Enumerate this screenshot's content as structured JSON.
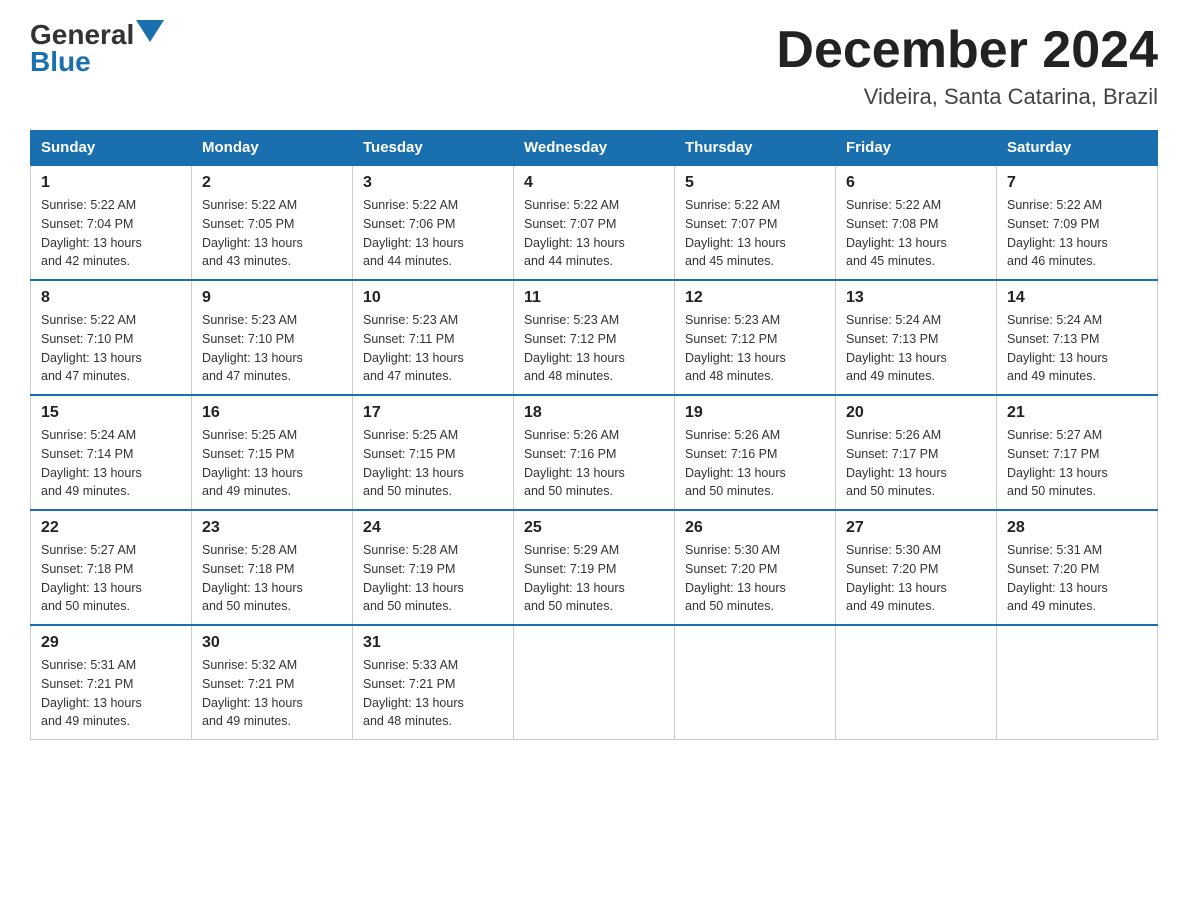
{
  "logo": {
    "text1": "General",
    "text2": "Blue"
  },
  "title": "December 2024",
  "location": "Videira, Santa Catarina, Brazil",
  "days_of_week": [
    "Sunday",
    "Monday",
    "Tuesday",
    "Wednesday",
    "Thursday",
    "Friday",
    "Saturday"
  ],
  "weeks": [
    [
      {
        "day": "1",
        "sunrise": "5:22 AM",
        "sunset": "7:04 PM",
        "daylight": "13 hours and 42 minutes."
      },
      {
        "day": "2",
        "sunrise": "5:22 AM",
        "sunset": "7:05 PM",
        "daylight": "13 hours and 43 minutes."
      },
      {
        "day": "3",
        "sunrise": "5:22 AM",
        "sunset": "7:06 PM",
        "daylight": "13 hours and 44 minutes."
      },
      {
        "day": "4",
        "sunrise": "5:22 AM",
        "sunset": "7:07 PM",
        "daylight": "13 hours and 44 minutes."
      },
      {
        "day": "5",
        "sunrise": "5:22 AM",
        "sunset": "7:07 PM",
        "daylight": "13 hours and 45 minutes."
      },
      {
        "day": "6",
        "sunrise": "5:22 AM",
        "sunset": "7:08 PM",
        "daylight": "13 hours and 45 minutes."
      },
      {
        "day": "7",
        "sunrise": "5:22 AM",
        "sunset": "7:09 PM",
        "daylight": "13 hours and 46 minutes."
      }
    ],
    [
      {
        "day": "8",
        "sunrise": "5:22 AM",
        "sunset": "7:10 PM",
        "daylight": "13 hours and 47 minutes."
      },
      {
        "day": "9",
        "sunrise": "5:23 AM",
        "sunset": "7:10 PM",
        "daylight": "13 hours and 47 minutes."
      },
      {
        "day": "10",
        "sunrise": "5:23 AM",
        "sunset": "7:11 PM",
        "daylight": "13 hours and 47 minutes."
      },
      {
        "day": "11",
        "sunrise": "5:23 AM",
        "sunset": "7:12 PM",
        "daylight": "13 hours and 48 minutes."
      },
      {
        "day": "12",
        "sunrise": "5:23 AM",
        "sunset": "7:12 PM",
        "daylight": "13 hours and 48 minutes."
      },
      {
        "day": "13",
        "sunrise": "5:24 AM",
        "sunset": "7:13 PM",
        "daylight": "13 hours and 49 minutes."
      },
      {
        "day": "14",
        "sunrise": "5:24 AM",
        "sunset": "7:13 PM",
        "daylight": "13 hours and 49 minutes."
      }
    ],
    [
      {
        "day": "15",
        "sunrise": "5:24 AM",
        "sunset": "7:14 PM",
        "daylight": "13 hours and 49 minutes."
      },
      {
        "day": "16",
        "sunrise": "5:25 AM",
        "sunset": "7:15 PM",
        "daylight": "13 hours and 49 minutes."
      },
      {
        "day": "17",
        "sunrise": "5:25 AM",
        "sunset": "7:15 PM",
        "daylight": "13 hours and 50 minutes."
      },
      {
        "day": "18",
        "sunrise": "5:26 AM",
        "sunset": "7:16 PM",
        "daylight": "13 hours and 50 minutes."
      },
      {
        "day": "19",
        "sunrise": "5:26 AM",
        "sunset": "7:16 PM",
        "daylight": "13 hours and 50 minutes."
      },
      {
        "day": "20",
        "sunrise": "5:26 AM",
        "sunset": "7:17 PM",
        "daylight": "13 hours and 50 minutes."
      },
      {
        "day": "21",
        "sunrise": "5:27 AM",
        "sunset": "7:17 PM",
        "daylight": "13 hours and 50 minutes."
      }
    ],
    [
      {
        "day": "22",
        "sunrise": "5:27 AM",
        "sunset": "7:18 PM",
        "daylight": "13 hours and 50 minutes."
      },
      {
        "day": "23",
        "sunrise": "5:28 AM",
        "sunset": "7:18 PM",
        "daylight": "13 hours and 50 minutes."
      },
      {
        "day": "24",
        "sunrise": "5:28 AM",
        "sunset": "7:19 PM",
        "daylight": "13 hours and 50 minutes."
      },
      {
        "day": "25",
        "sunrise": "5:29 AM",
        "sunset": "7:19 PM",
        "daylight": "13 hours and 50 minutes."
      },
      {
        "day": "26",
        "sunrise": "5:30 AM",
        "sunset": "7:20 PM",
        "daylight": "13 hours and 50 minutes."
      },
      {
        "day": "27",
        "sunrise": "5:30 AM",
        "sunset": "7:20 PM",
        "daylight": "13 hours and 49 minutes."
      },
      {
        "day": "28",
        "sunrise": "5:31 AM",
        "sunset": "7:20 PM",
        "daylight": "13 hours and 49 minutes."
      }
    ],
    [
      {
        "day": "29",
        "sunrise": "5:31 AM",
        "sunset": "7:21 PM",
        "daylight": "13 hours and 49 minutes."
      },
      {
        "day": "30",
        "sunrise": "5:32 AM",
        "sunset": "7:21 PM",
        "daylight": "13 hours and 49 minutes."
      },
      {
        "day": "31",
        "sunrise": "5:33 AM",
        "sunset": "7:21 PM",
        "daylight": "13 hours and 48 minutes."
      },
      null,
      null,
      null,
      null
    ]
  ],
  "labels": {
    "sunrise": "Sunrise:",
    "sunset": "Sunset:",
    "daylight": "Daylight:"
  }
}
